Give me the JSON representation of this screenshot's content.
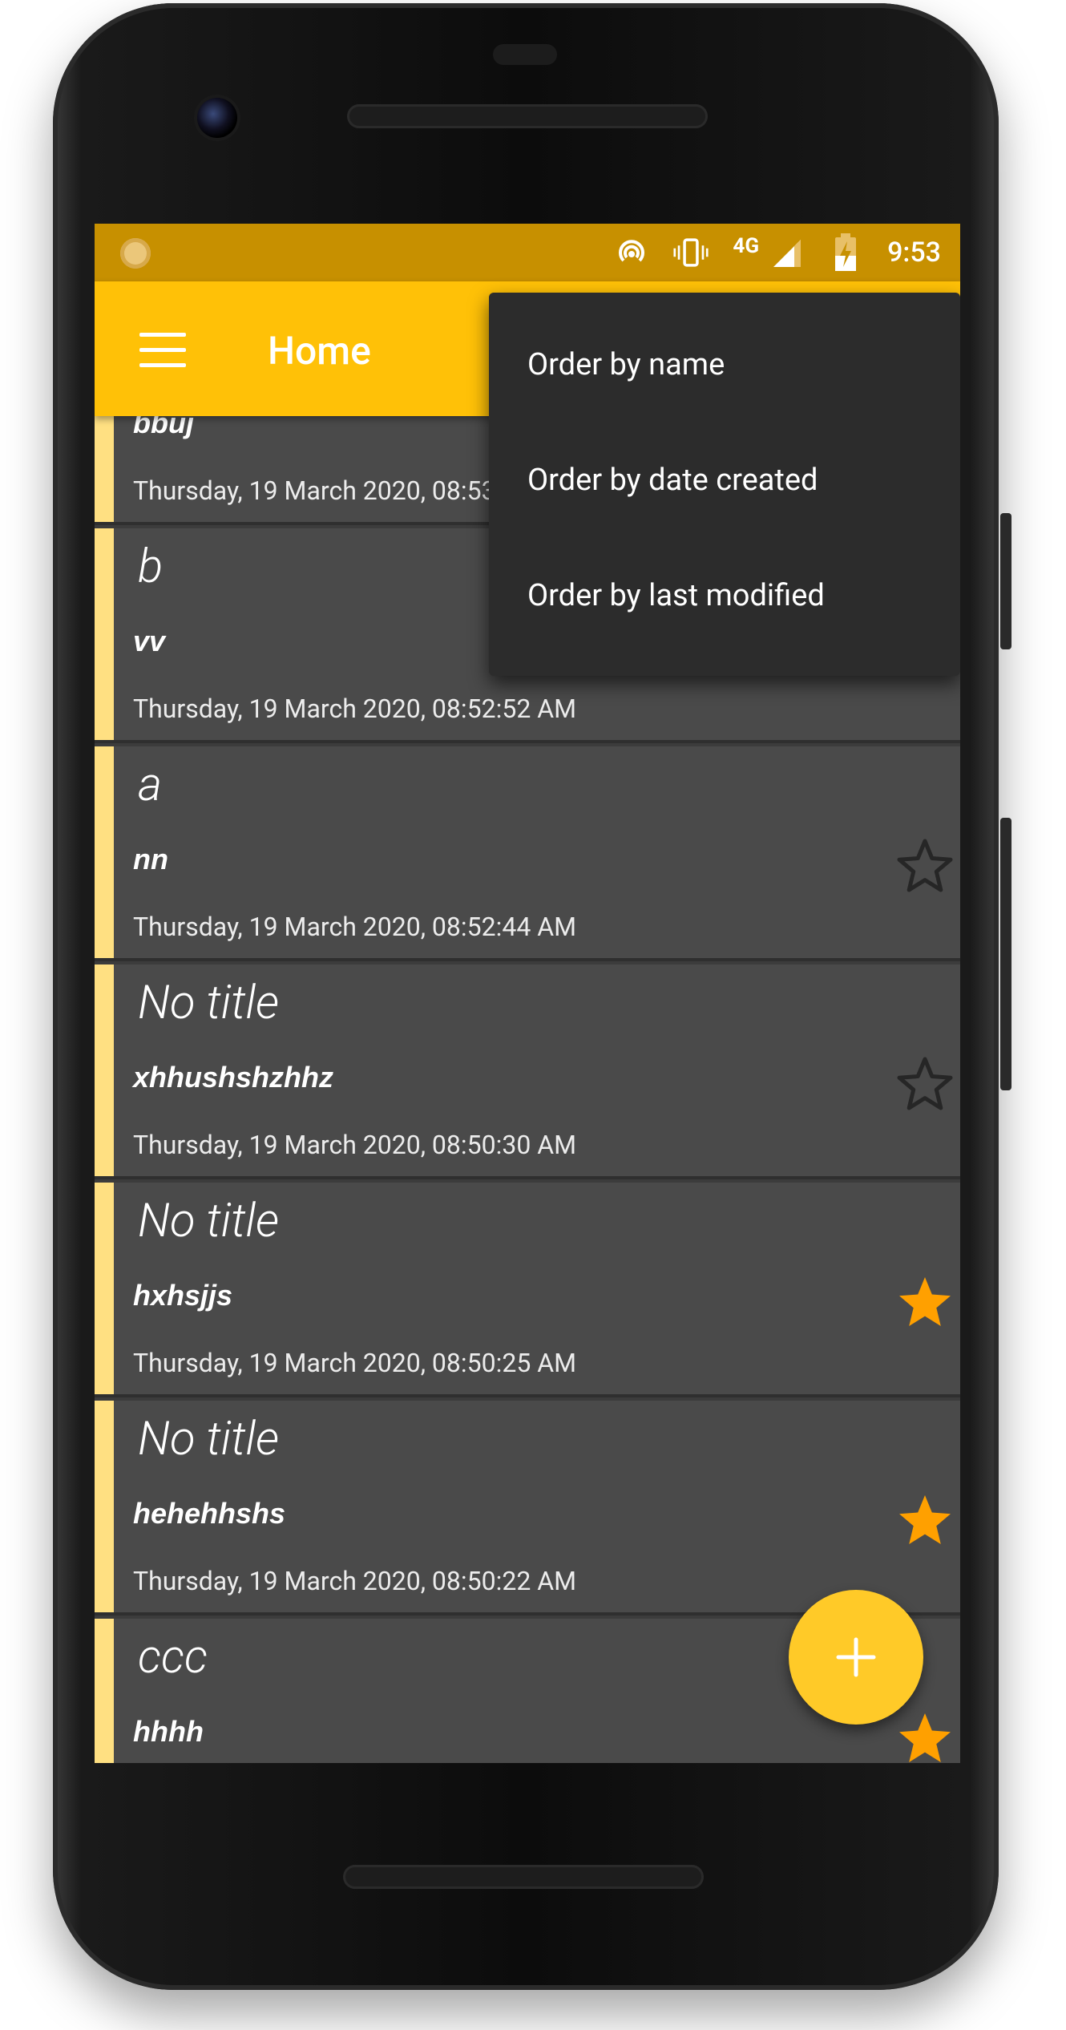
{
  "status_bar": {
    "network": "4G",
    "time": "9:53"
  },
  "app_bar": {
    "title": "Home"
  },
  "sort_menu": {
    "items": [
      "Order by name",
      "Order by date created",
      "Order by last modified"
    ]
  },
  "notes": [
    {
      "title": "",
      "body": "bbuj",
      "date": "Thursday, 19 March 2020, 08:53",
      "starred": false
    },
    {
      "title": "b",
      "body": "vv",
      "date": "Thursday, 19 March 2020, 08:52:52 AM",
      "starred": false
    },
    {
      "title": "a",
      "body": "nn",
      "date": "Thursday, 19 March 2020, 08:52:44 AM",
      "starred": false
    },
    {
      "title": "No title",
      "body": "xhhushshzhhz",
      "date": "Thursday, 19 March 2020, 08:50:30 AM",
      "starred": false
    },
    {
      "title": "No title",
      "body": "hxhsjjs",
      "date": "Thursday, 19 March 2020, 08:50:25 AM",
      "starred": true
    },
    {
      "title": "No title",
      "body": "hehehhshs",
      "date": "Thursday, 19 March 2020, 08:50:22 AM",
      "starred": true
    },
    {
      "title": "ccc",
      "body": "hhhh",
      "date": "",
      "starred": true
    }
  ],
  "fab": {
    "icon": "plus-icon"
  },
  "colors": {
    "status_bar": "#c79000",
    "app_bar": "#ffc107",
    "fab": "#ffca28",
    "star_filled": "#ffa000",
    "note_strip": "#ffe082"
  }
}
